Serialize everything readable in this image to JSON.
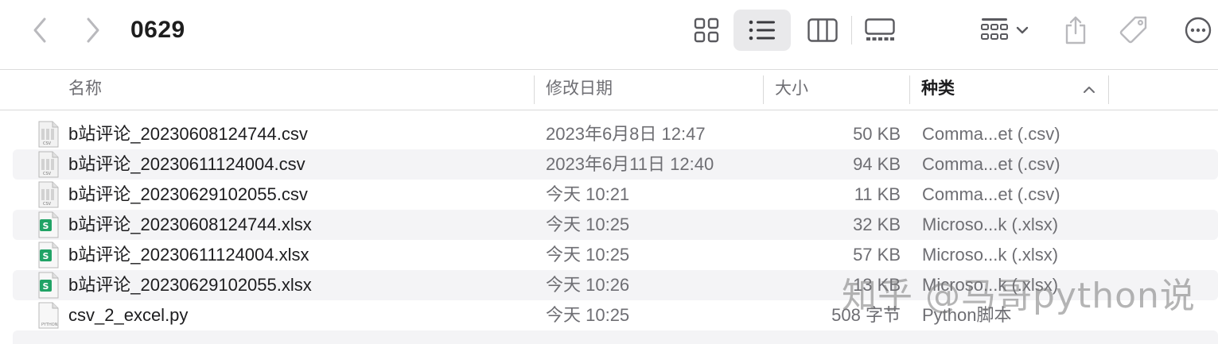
{
  "window": {
    "title": "0629"
  },
  "toolbar": {
    "back_icon": "chevron-left-icon",
    "forward_icon": "chevron-right-icon",
    "views": [
      "grid-view-icon",
      "list-view-icon",
      "column-view-icon",
      "gallery-view-icon"
    ],
    "active_view": "list-view-icon",
    "group_icon": "group-by-icon",
    "share_icon": "share-icon",
    "tag_icon": "tag-icon",
    "more_icon": "more-icon"
  },
  "columns": {
    "name": "名称",
    "date": "修改日期",
    "size": "大小",
    "kind": "种类",
    "sort_icon": "chevron-up-icon"
  },
  "files": [
    {
      "name": "b站评论_20230608124744.csv",
      "date": "2023年6月8日 12:47",
      "size": "50 KB",
      "kind": "Comma...et (.csv)",
      "icon": "csv-file-icon"
    },
    {
      "name": "b站评论_20230611124004.csv",
      "date": "2023年6月11日 12:40",
      "size": "94 KB",
      "kind": "Comma...et (.csv)",
      "icon": "csv-file-icon"
    },
    {
      "name": "b站评论_20230629102055.csv",
      "date": "今天 10:21",
      "size": "11 KB",
      "kind": "Comma...et (.csv)",
      "icon": "csv-file-icon"
    },
    {
      "name": "b站评论_20230608124744.xlsx",
      "date": "今天 10:25",
      "size": "32 KB",
      "kind": "Microso...k (.xlsx)",
      "icon": "xlsx-file-icon"
    },
    {
      "name": "b站评论_20230611124004.xlsx",
      "date": "今天 10:25",
      "size": "57 KB",
      "kind": "Microso...k (.xlsx)",
      "icon": "xlsx-file-icon"
    },
    {
      "name": "b站评论_20230629102055.xlsx",
      "date": "今天 10:26",
      "size": "13 KB",
      "kind": "Microso...k (.xlsx)",
      "icon": "xlsx-file-icon"
    },
    {
      "name": "csv_2_excel.py",
      "date": "今天 10:25",
      "size": "508 字节",
      "kind": "Python脚本",
      "icon": "python-file-icon"
    }
  ],
  "watermark": "知乎 @马哥python说",
  "colors": {
    "xlsx_green": "#21a366",
    "row_alt": "#f4f4f6",
    "selected_view_bg": "#e9e9eb"
  }
}
